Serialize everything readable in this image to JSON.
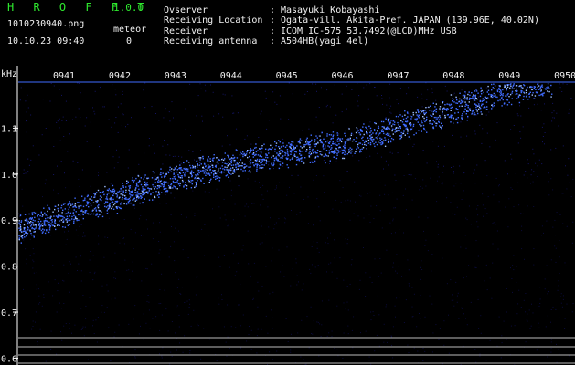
{
  "header": {
    "app_title": "H R O F F T",
    "app_version": "1.0.0",
    "filename": "1010230940.png",
    "event_type_label": "meteor",
    "datetime": "10.10.23 09:40",
    "meteor_count": "0"
  },
  "info": [
    {
      "label": "Ovserver",
      "value": "Masayuki Kobayashi"
    },
    {
      "label": "Receiving Location",
      "value": "Ogata-vill. Akita-Pref. JAPAN (139.96E, 40.02N)"
    },
    {
      "label": "Receiver",
      "value": "ICOM IC-575 53.7492(@LCD)MHz USB"
    },
    {
      "label": "Receiving antenna",
      "value": "A504HB(yagi 4el)"
    }
  ],
  "chart_data": {
    "type": "heatmap",
    "y_unit_label": "kHz",
    "y_tick_labels": [
      "1.1",
      "1.0",
      "0.9",
      "0.8",
      "0.7",
      "0.6"
    ],
    "y_ticks": [
      1.1,
      1.0,
      0.9,
      0.8,
      0.7,
      0.6
    ],
    "x_tick_labels": [
      "0941",
      "0942",
      "0943",
      "0944",
      "0945",
      "0946",
      "0947",
      "0948",
      "0949",
      "0950"
    ],
    "ylim": [
      0.585,
      1.2
    ],
    "xlim": [
      0,
      10
    ],
    "trace": {
      "description": "signal frequency drift",
      "points": [
        {
          "t": 0.0,
          "f": 0.88
        },
        {
          "t": 1.0,
          "f": 0.92
        },
        {
          "t": 2.0,
          "f": 0.96
        },
        {
          "t": 3.0,
          "f": 1.0
        },
        {
          "t": 4.0,
          "f": 1.03
        },
        {
          "t": 5.0,
          "f": 1.05
        },
        {
          "t": 6.0,
          "f": 1.07
        },
        {
          "t": 7.0,
          "f": 1.11
        },
        {
          "t": 8.0,
          "f": 1.15
        },
        {
          "t": 9.0,
          "f": 1.19
        },
        {
          "t": 9.6,
          "f": 1.2
        }
      ]
    },
    "colors": {
      "background": "#000000",
      "signal": "#3f6bff",
      "signal_bright": "#9fc0ff",
      "noise": "#0b0b3c",
      "axis": "#ffffff"
    }
  }
}
